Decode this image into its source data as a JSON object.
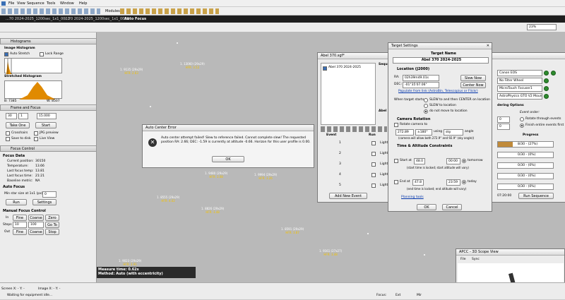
{
  "menu": [
    "File",
    "View",
    "Sequence",
    "Tools",
    "Window",
    "Help"
  ],
  "toolbar": {
    "modules_label": "Modules:"
  },
  "tabs": [
    "...70 2024-2025_1200sec_1x1_0001",
    "...70 2024-2025_1200sec_1x1_0008",
    "Auto Focus"
  ],
  "zoom": "23%",
  "histograms": {
    "title": "Histograms",
    "image_hist": "Image Histogram",
    "auto_stretch": "Auto Stretch",
    "lock_range": "Lock Range",
    "stretched": "Stretched Histogram",
    "b": "B: 7385",
    "w": "W: 8507"
  },
  "frame_focus": {
    "title": "Frame and Focus",
    "exposure": "30",
    "bin": "1",
    "time": "15.000",
    "take_one": "Take One",
    "start": "Start",
    "crosshairs": "Crosshairs",
    "jpg_preview": "JPG preview",
    "save_to_disk": "Save to disk",
    "live_view": "Live View"
  },
  "focus_control": {
    "title": "Focus Control",
    "focus_data": "Focus Data",
    "rows": [
      [
        "Current position:",
        "30150"
      ],
      [
        "Temperature:",
        "13.66"
      ],
      [
        "Last focus temp:",
        "13.81"
      ],
      [
        "Last focus time:",
        "21:21"
      ],
      [
        "Baseline metric:",
        "NA"
      ]
    ],
    "auto_focus": "Auto Focus",
    "min_star": "Min star size at 1x1 (px):",
    "min_star_val": "0",
    "run": "Run",
    "settings": "Settings",
    "manual": "Manual Focus Control",
    "in": "In",
    "out": "Out",
    "steps": "Steps",
    "fine": "Fine",
    "coarse": "Coarse",
    "zero": "Zero",
    "stop": "Stop",
    "goto": "Go To",
    "step_a": "10",
    "step_b": "100",
    "goto_val": "100"
  },
  "error": {
    "title": "Auto Center Error",
    "message": "Auto center attempt failed! Slew to reference failed. Cannot complete slew! The requested position RA: 2.66; DEC: -1.59 is currently at altitude -0.66. Horizon for this user profile is 0.00.",
    "ok": "OK"
  },
  "stars": [
    {
      "n": "1. 9135 (29x29)",
      "h": "HFR: 2.63"
    },
    {
      "n": "1. 13060 (29x29)",
      "h": "HFR: 3.52"
    },
    {
      "n": "1. 9480 (29x29)",
      "h": "HFR: 3.08"
    },
    {
      "n": "1. 9994 (29x29)",
      "h": "HFR: 3.26"
    },
    {
      "n": "1. 8555 (29x29)",
      "h": "HFR: 4.02"
    },
    {
      "n": "1. 8826 (29x29)",
      "h": "HFR: 3.48"
    },
    {
      "n": "1. 8591 (29x29)",
      "h": "HFR: 3.87"
    },
    {
      "n": "1. 9161 (27x27)",
      "h": "HFR: 3.48"
    },
    {
      "n": "1. 9023 (29x29)",
      "h": "HFR: 2.91"
    }
  ],
  "measure": {
    "time": "Measure time: 0.62s",
    "method": "Method: Auto (with eccentricity)"
  },
  "status": {
    "screen": "Screen X: - Y: -",
    "image": "Image X: - Y: -",
    "waiting": "Waiting for equipment idle...",
    "focus": "Focus:",
    "extra": "Ext",
    "misc": "Mir"
  },
  "sequence": {
    "title": "Abel 370.sgf*",
    "target_item": "Abel 370 2024-2025",
    "seq_label": "Seque",
    "abel_label": "Abel 3",
    "event_col": "Event",
    "run_col": "Run",
    "light": "Light",
    "add_event": "Add New Event",
    "event_nums": [
      "1",
      "2",
      "3",
      "4",
      "5"
    ]
  },
  "target": {
    "title": "Target Settings",
    "name_hdr": "Target Name",
    "name": "Abel 370 2024-2025",
    "location": "Location (J2000)",
    "ra_lbl": "RA:",
    "ra": "02h39m49.01s",
    "dec_lbl": "DEC:",
    "dec": "-01°35'07.06\"",
    "slew_now": "Slew Now",
    "center_now": "Center Now",
    "populate": "Populate from link (AstroBin, Telescopius or Flickr)",
    "starts_lbl": "When target starts",
    "opt1": "SLEW to and then CENTER on location",
    "opt2": "SLEW to location",
    "opt3": "do not move to location",
    "rotation": "Camera Rotation",
    "rotate": "Rotate camera to",
    "angle_val": "272.89",
    "pm": "±180°",
    "using": "using",
    "sky": "sky",
    "angle": "angle",
    "rot_note": "(camera will allow both 272.9° and 92.9° (sky angle))",
    "time_hdr": "Time & Altitude Constraints",
    "start_at": "Start at",
    "alt1": "48.0",
    "time1": "00:00",
    "tomorrow": "tomorrow",
    "start_note": "(start time is locked; start altitude will vary)",
    "end_at": "End at",
    "alt2": "47.8",
    "time2": "23:59",
    "today": "today",
    "end_note": "(end time is locked; end altitude will vary)",
    "planning": "Planning tools",
    "ok": "OK",
    "cancel": "Cancel"
  },
  "equipment": {
    "camera": "Canon EOS",
    "filter": "No Filter Wheel",
    "focuser": "MicroTouch Focuser1",
    "mount": "AstroPhysics GTO V2 Mount",
    "ordering": "dering Options",
    "event_order": "Event order:",
    "rotate_events": "Rotate through events",
    "finish_first": "Finish entire events first",
    "spin1": "0",
    "spin2": "0",
    "progress_hdr": "Progress",
    "prog": [
      "8/30 - (27%)",
      "0/30 - (0%)",
      "0/30 - (0%)",
      "0/30 - (0%)",
      "0/30 - (0%)"
    ],
    "time": "07:20:00",
    "run_seq": "Run Sequence"
  },
  "scope": {
    "title": "APCC - 3D Scope View",
    "file": "File",
    "sync": "Sync"
  }
}
